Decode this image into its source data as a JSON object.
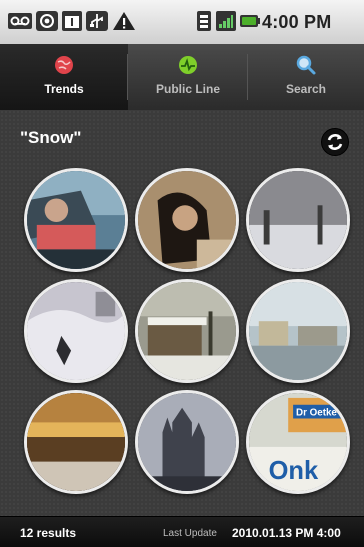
{
  "status_bar": {
    "time": "4:00 PM",
    "icons": [
      "voicemail-icon",
      "at-sign-icon",
      "calendar-icon",
      "usb-icon",
      "warning-icon",
      "sim-icon",
      "signal-icon",
      "battery-icon"
    ]
  },
  "tabs": [
    {
      "label": "Trends",
      "icon": "globe-icon",
      "active": true
    },
    {
      "label": "Public Line",
      "icon": "public-line-icon",
      "active": false
    },
    {
      "label": "Search",
      "icon": "search-icon",
      "active": false
    }
  ],
  "content": {
    "query": "\"Snow\"",
    "refresh_icon": "refresh-icon",
    "photos": [
      {
        "subject": "car window"
      },
      {
        "subject": "person with dark hair"
      },
      {
        "subject": "snowy yard"
      },
      {
        "subject": "snow-covered scene"
      },
      {
        "subject": "snowy building"
      },
      {
        "subject": "houses in snow"
      },
      {
        "subject": "sunset street"
      },
      {
        "subject": "cathedral"
      },
      {
        "subject": "Dr. Oetker / Onko packaging",
        "visible_text_1": "Dr Oetke",
        "visible_text_2": "Onk"
      }
    ]
  },
  "footer": {
    "results": "12 results",
    "last_update_label": "Last Update",
    "last_update_value": "2010.01.13 PM 4:00"
  },
  "colors": {
    "background": "#3b3b3b",
    "status_bar": "#e2e2e2",
    "tab_bar": "#2b2b2b",
    "battery_green": "#4caf2a",
    "trends_red": "#e0444b",
    "public_line_green": "#7fcf2a",
    "search_blue": "#5aa9e0"
  }
}
